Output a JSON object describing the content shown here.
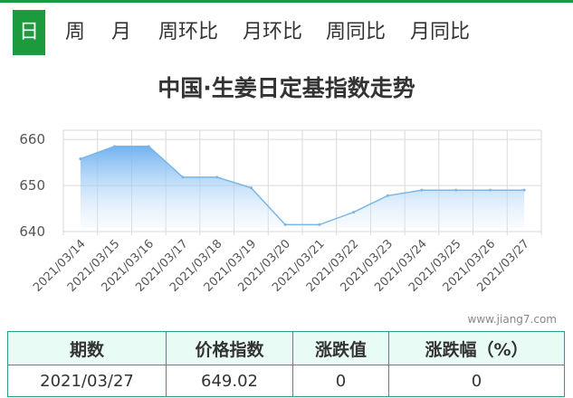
{
  "tabs": [
    {
      "label": "日",
      "active": true
    },
    {
      "label": "周",
      "active": false
    },
    {
      "label": "月",
      "active": false
    },
    {
      "label": "周环比",
      "active": false
    },
    {
      "label": "月环比",
      "active": false
    },
    {
      "label": "周同比",
      "active": false
    },
    {
      "label": "月同比",
      "active": false
    }
  ],
  "chart_title": "中国·生姜日定基指数走势",
  "watermark": "www.jiang7.com",
  "colors": {
    "accent": "#1d9a3e",
    "line": "#7ab6e6",
    "table_border": "#2a9b8f",
    "header_bg": "#e9fbf5"
  },
  "chart_data": {
    "type": "area",
    "title": "中国·生姜日定基指数走势",
    "x": [
      "2021/03/14",
      "2021/03/15",
      "2021/03/16",
      "2021/03/17",
      "2021/03/18",
      "2021/03/19",
      "2021/03/20",
      "2021/03/21",
      "2021/03/22",
      "2021/03/23",
      "2021/03/24",
      "2021/03/25",
      "2021/03/26",
      "2021/03/27"
    ],
    "values": [
      655.8,
      658.5,
      658.5,
      651.8,
      651.8,
      649.5,
      641.5,
      641.5,
      644.2,
      647.8,
      649.0,
      649.0,
      649.0,
      649.0
    ],
    "yticks": [
      640,
      650,
      660
    ],
    "ylim": [
      640,
      662
    ],
    "grid": true
  },
  "table": {
    "headers": [
      "期数",
      "价格指数",
      "涨跌值",
      "涨跌幅（%）"
    ],
    "rows": [
      [
        "2021/03/27",
        "649.02",
        "0",
        "0"
      ]
    ]
  }
}
